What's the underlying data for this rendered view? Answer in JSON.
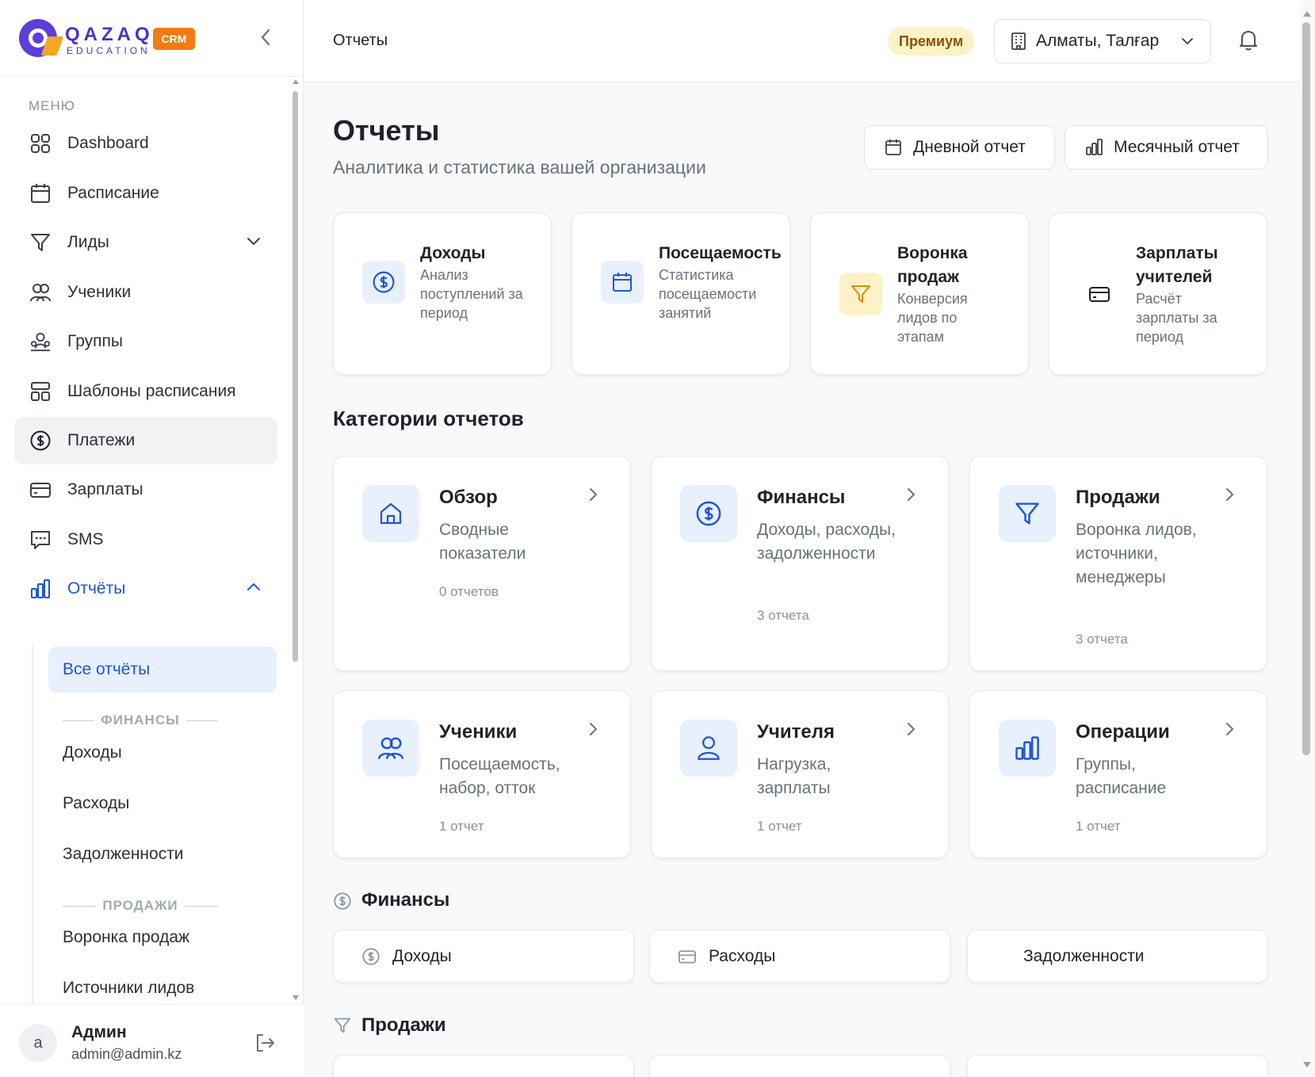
{
  "brand": {
    "name": "QAZAQ",
    "sub": "EDUCATION",
    "badge": "CRM"
  },
  "sidebar": {
    "menu_title": "МЕНЮ",
    "items": [
      {
        "label": "Dashboard"
      },
      {
        "label": "Расписание"
      },
      {
        "label": "Лиды"
      },
      {
        "label": "Ученики"
      },
      {
        "label": "Группы"
      },
      {
        "label": "Шаблоны расписания"
      },
      {
        "label": "Платежи"
      },
      {
        "label": "Зарплаты"
      },
      {
        "label": "SMS"
      },
      {
        "label": "Отчёты"
      }
    ],
    "sub": {
      "all": "Все отчёты",
      "finance_head": "ФИНАНСЫ",
      "income": "Доходы",
      "expenses": "Расходы",
      "debts": "Задолженности",
      "sales_head": "ПРОДАЖИ",
      "funnel": "Воронка продаж",
      "sources": "Источники лидов"
    },
    "user": {
      "avatar": "a",
      "name": "Админ",
      "email": "admin@admin.kz"
    }
  },
  "header": {
    "title": "Отчеты",
    "premium": "Премиум",
    "branch": "Алматы, Талғар"
  },
  "page": {
    "title": "Отчеты",
    "subtitle": "Аналитика и статистика вашей организации",
    "daily_btn": "Дневной отчет",
    "monthly_btn": "Месячный отчет"
  },
  "quick": [
    {
      "title": "Доходы",
      "desc": "Анализ поступлений за период",
      "icon": "dollar-icon",
      "color": "#1f55d6"
    },
    {
      "title": "Посещаемость",
      "desc": "Статистика посещаемости занятий",
      "icon": "calendar-icon",
      "color": "#1f55d6"
    },
    {
      "title": "Воронка продаж",
      "desc": "Конверсия лидов по этапам",
      "icon": "funnel-icon",
      "color": "#e08a00"
    },
    {
      "title": "Зарплаты учителей",
      "desc": "Расчёт зарплаты за период",
      "icon": "card-icon",
      "color": "#1f2329"
    }
  ],
  "categories_title": "Категории отчетов",
  "categories": [
    {
      "title": "Обзор",
      "desc": "Сводные показатели",
      "count": "0 отчетов",
      "icon": "home-icon"
    },
    {
      "title": "Финансы",
      "desc": "Доходы, расходы, задолженности",
      "count": "3 отчета",
      "icon": "dollar-icon"
    },
    {
      "title": "Продажи",
      "desc": "Воронка лидов, источники, менеджеры",
      "count": "3 отчета",
      "icon": "funnel-icon"
    },
    {
      "title": "Ученики",
      "desc": "Посещаемость, набор, отток",
      "count": "1 отчет",
      "icon": "users-icon"
    },
    {
      "title": "Учителя",
      "desc": "Нагрузка, зарплаты",
      "count": "1 отчет",
      "icon": "user-icon"
    },
    {
      "title": "Операции",
      "desc": "Группы, расписание",
      "count": "1 отчет",
      "icon": "chart-icon"
    }
  ],
  "finance_section": {
    "title": "Финансы",
    "links": [
      "Доходы",
      "Расходы",
      "Задолженности"
    ]
  },
  "sales_section": {
    "title": "Продажи"
  }
}
